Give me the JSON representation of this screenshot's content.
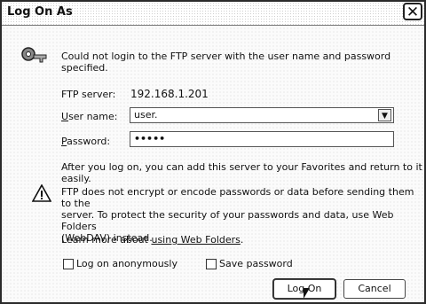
{
  "window": {
    "title": "Log On As"
  },
  "icons": {
    "close": "close-icon",
    "keys": "key-icon",
    "warning": "warning-icon"
  },
  "message": {
    "text": "Could not login to the FTP server with the user name and password specified."
  },
  "form": {
    "server_label": "FTP server:",
    "server_value": "192.168.1.201",
    "username_label_prefix": "U",
    "username_label_rest": "ser name:",
    "username_value": "user.",
    "password_label_prefix": "P",
    "password_label_rest": "assword:",
    "password_value": "•••••"
  },
  "info": {
    "text": "After you log on, you can add this server to your Favorites and return to it easily."
  },
  "warning": {
    "line1": "FTP does not encrypt or encode passwords or data before sending them to the",
    "line2": "server.  To protect the security of your passwords and data, use Web Folders",
    "line3": "(WebDAV) instead."
  },
  "learn_more": {
    "text": "Learn more about ",
    "link": "using Web Folders",
    "suffix": "."
  },
  "options": {
    "anonymous_label": "Log on anonymously",
    "save_password_label": "Save password"
  },
  "buttons": {
    "logon": "Log On",
    "cancel": "Cancel"
  }
}
